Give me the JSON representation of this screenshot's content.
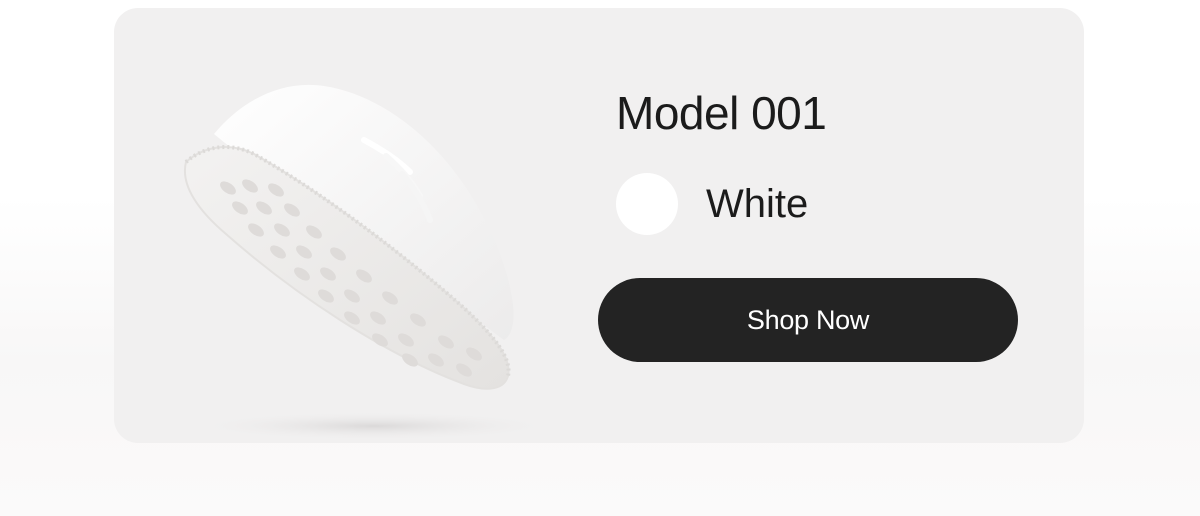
{
  "product": {
    "title": "Model 001",
    "color_name": "White",
    "swatch_color": "#ffffff",
    "cta_label": "Shop Now",
    "cta_color": "#232323"
  },
  "card": {
    "background": "#f1f0f0"
  }
}
